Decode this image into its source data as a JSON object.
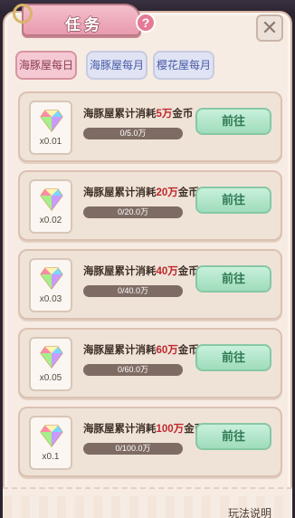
{
  "header": {
    "title": "任务",
    "help_icon": "question-icon",
    "close_icon": "close-icon"
  },
  "tabs": [
    {
      "label": "海豚屋每日",
      "active": true
    },
    {
      "label": "海豚屋每月",
      "active": false
    },
    {
      "label": "樱花屋每月",
      "active": false
    }
  ],
  "tasks": [
    {
      "reward_icon": "rainbow-gem-icon",
      "reward": "x0.01",
      "desc_prefix": "海豚屋累计消耗",
      "desc_amount": "5万",
      "desc_suffix": "金币",
      "progress_text": "0/5.0万",
      "progress": 0,
      "button": "前往"
    },
    {
      "reward_icon": "rainbow-gem-icon",
      "reward": "x0.02",
      "desc_prefix": "海豚屋累计消耗",
      "desc_amount": "20万",
      "desc_suffix": "金币",
      "progress_text": "0/20.0万",
      "progress": 0,
      "button": "前往"
    },
    {
      "reward_icon": "rainbow-gem-icon",
      "reward": "x0.03",
      "desc_prefix": "海豚屋累计消耗",
      "desc_amount": "40万",
      "desc_suffix": "金币",
      "progress_text": "0/40.0万",
      "progress": 0,
      "button": "前往"
    },
    {
      "reward_icon": "rainbow-gem-icon",
      "reward": "x0.05",
      "desc_prefix": "海豚屋累计消耗",
      "desc_amount": "60万",
      "desc_suffix": "金币",
      "progress_text": "0/60.0万",
      "progress": 0,
      "button": "前往"
    },
    {
      "reward_icon": "rainbow-gem-icon",
      "reward": "x0.1",
      "desc_prefix": "海豚屋累计消耗",
      "desc_amount": "100万",
      "desc_suffix": "金币",
      "progress_text": "0/100.0万",
      "progress": 0,
      "button": "前往"
    }
  ],
  "footer": {
    "partial_text": "玩法说明"
  },
  "colors": {
    "accent_pink": "#e89aae",
    "go_green": "#9fdcbc",
    "highlight_red": "#c0272d"
  }
}
